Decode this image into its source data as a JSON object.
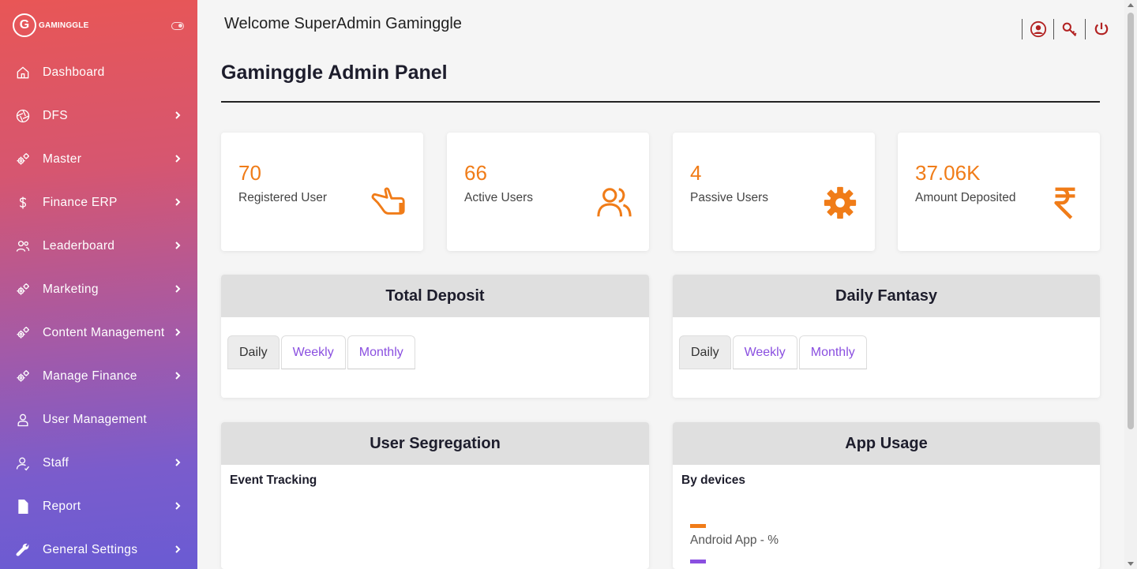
{
  "sidebar": {
    "logo_letter": "G",
    "logo_text": "GAMINGGLE",
    "items": [
      {
        "label": "Dashboard"
      },
      {
        "label": "DFS"
      },
      {
        "label": "Master"
      },
      {
        "label": "Finance ERP"
      },
      {
        "label": "Leaderboard"
      },
      {
        "label": "Marketing"
      },
      {
        "label": "Content Management"
      },
      {
        "label": "Manage Finance"
      },
      {
        "label": "User Management"
      },
      {
        "label": "Staff"
      },
      {
        "label": "Report"
      },
      {
        "label": "General Settings"
      }
    ]
  },
  "header": {
    "welcome": "Welcome SuperAdmin Gaminggle",
    "title": "Gaminggle Admin Panel"
  },
  "stats": [
    {
      "value": "70",
      "label": "Registered User",
      "icon": "hand-pointer-icon"
    },
    {
      "value": "66",
      "label": "Active Users",
      "icon": "users-icon"
    },
    {
      "value": "4",
      "label": "Passive Users",
      "icon": "gear-icon"
    },
    {
      "value": "37.06K",
      "label": "Amount Deposited",
      "icon": "rupee-icon"
    }
  ],
  "total_deposit": {
    "title": "Total Deposit",
    "tabs": [
      "Daily",
      "Weekly",
      "Monthly"
    ]
  },
  "daily_fantasy": {
    "title": "Daily Fantasy",
    "tabs": [
      "Daily",
      "Weekly",
      "Monthly"
    ]
  },
  "user_segregation": {
    "title": "User Segregation",
    "subtitle": "Event Tracking"
  },
  "app_usage": {
    "title": "App Usage",
    "subtitle": "By devices",
    "legend": [
      {
        "label": "Android App - %",
        "color": "#f07c18"
      },
      {
        "label": "",
        "color": "#8a4fe0"
      }
    ]
  },
  "colors": {
    "accent": "#f07c18",
    "tab_link": "#8a4fe0",
    "icon_red": "#b22222"
  }
}
